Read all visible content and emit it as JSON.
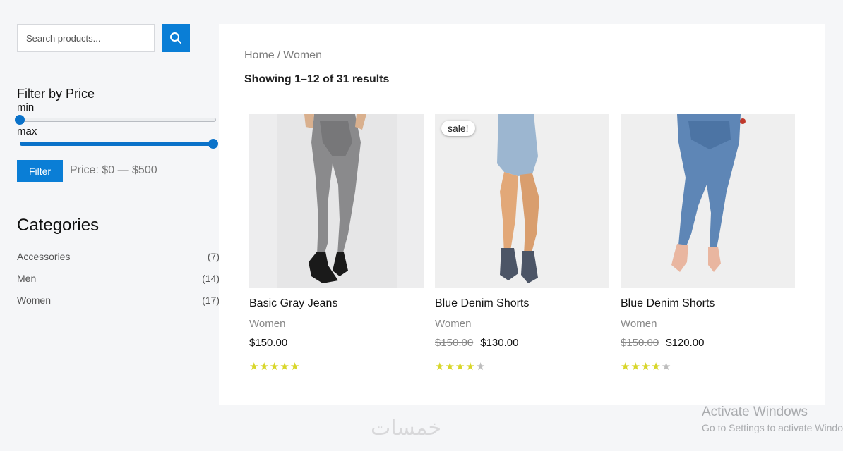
{
  "search": {
    "placeholder": "Search products...",
    "icon": "search-icon",
    "button_color": "#0a7ed6"
  },
  "price_filter": {
    "title": "Filter by Price",
    "min_label": "min",
    "max_label": "max",
    "min_value_fraction": 0,
    "max_value_fraction": 1,
    "button_label": "Filter",
    "price_text": "Price: $0 — $500"
  },
  "categories": {
    "title": "Categories",
    "items": [
      {
        "label": "Accessories",
        "count": "(7)"
      },
      {
        "label": "Men",
        "count": "(14)"
      },
      {
        "label": "Women",
        "count": "(17)"
      }
    ]
  },
  "main": {
    "breadcrumb": {
      "home": "Home",
      "separator": "/",
      "current": "Women"
    },
    "result_count": "Showing 1–12 of 31 results",
    "products": [
      {
        "name": "Basic Gray Jeans",
        "category": "Women",
        "old_price": "",
        "price": "$150.00",
        "rating": 5,
        "sale": "",
        "image": "gray-jeans-image"
      },
      {
        "name": "Blue Denim Shorts",
        "category": "Women",
        "old_price": "$150.00",
        "price": "$130.00",
        "rating": 4,
        "sale": "sale!",
        "image": "denim-shorts-image"
      },
      {
        "name": "Blue Denim Shorts",
        "category": "Women",
        "old_price": "$150.00",
        "price": "$120.00",
        "rating": 4,
        "sale": "",
        "image": "blue-jeans-image"
      }
    ]
  },
  "overlay": {
    "logo_text": "خمسات",
    "activate_title": "Activate Windows",
    "activate_sub": "Go to Settings to activate Windows."
  },
  "colors": {
    "accent": "#0a7ed6",
    "star_on": "#d8d62a",
    "star_off": "#bdbdbd"
  }
}
